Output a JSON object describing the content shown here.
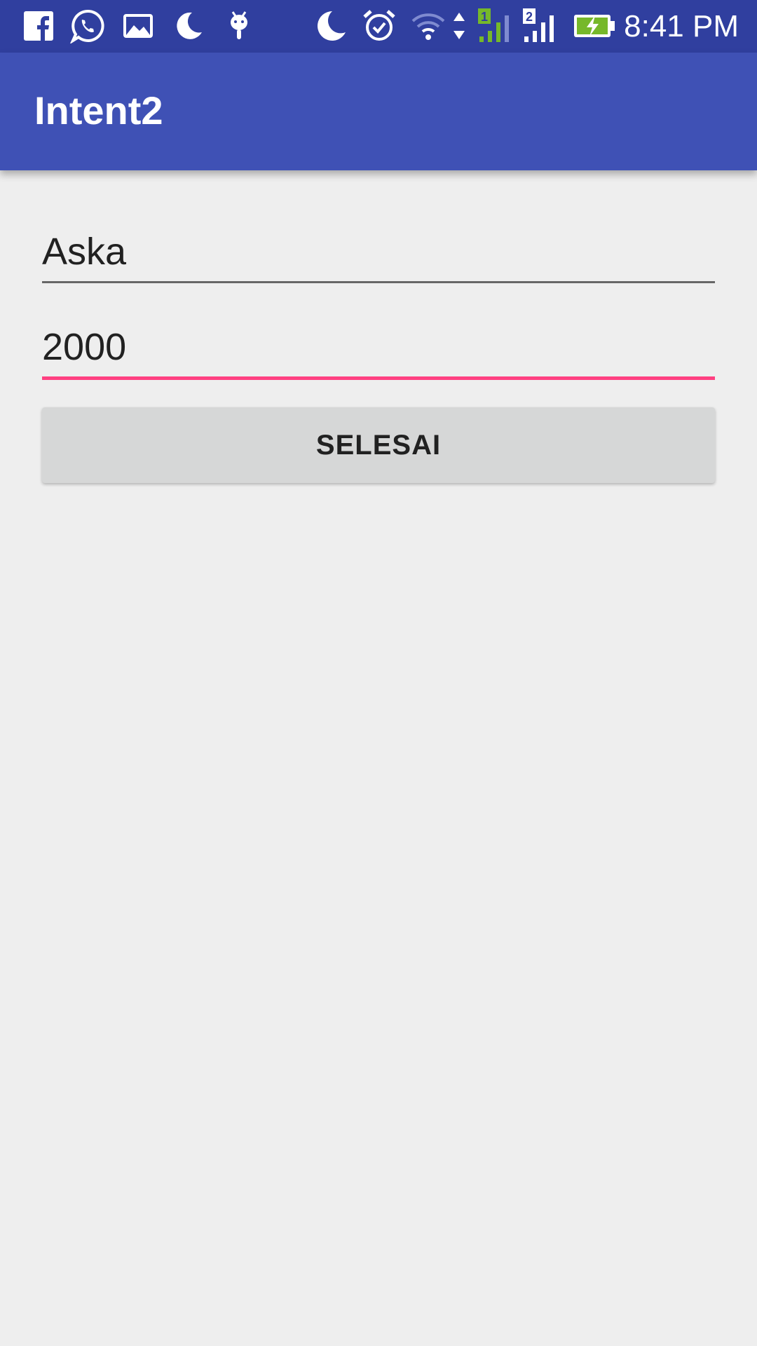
{
  "status_bar": {
    "time": "8:41 PM",
    "left_icons": [
      "facebook-icon",
      "whatsapp-icon",
      "gallery-icon",
      "moon-icon",
      "android-debug-icon"
    ],
    "right_icons": [
      "do-not-disturb-moon-icon",
      "alarm-icon",
      "wifi-icon",
      "data-arrows-icon",
      "signal-sim1-icon",
      "signal-sim2-icon",
      "battery-charging-icon"
    ],
    "sim1_label": "1",
    "sim2_label": "2"
  },
  "app_bar": {
    "title": "Intent2"
  },
  "form": {
    "name_value": "Aska",
    "amount_value": "2000",
    "submit_label": "SELESAI"
  },
  "colors": {
    "status_bar": "#303f9f",
    "app_bar": "#3f51b5",
    "accent": "#ff4081",
    "background": "#eeeeee"
  }
}
